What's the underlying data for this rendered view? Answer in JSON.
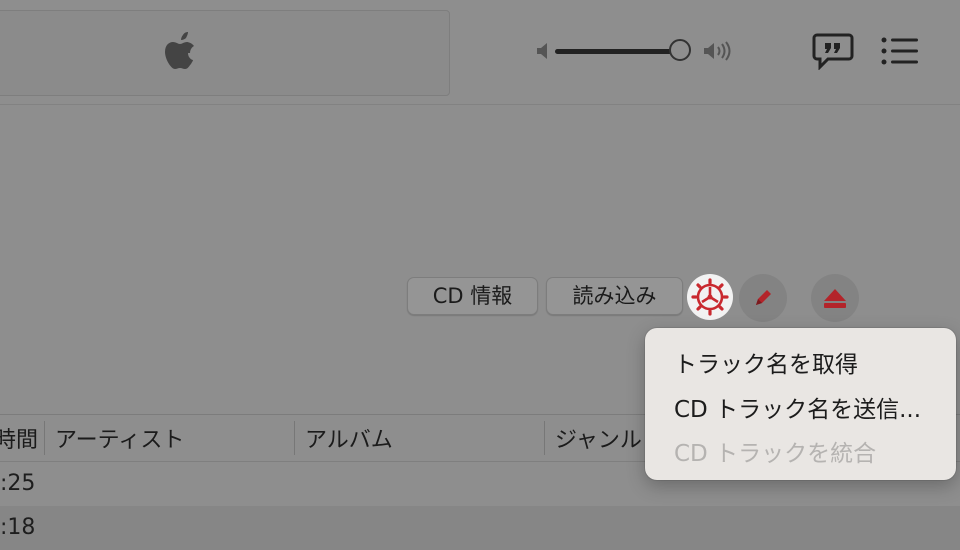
{
  "colors": {
    "accent_red": "#c9292f",
    "menu_bg": "#e9e6e3",
    "menu_disabled_text": "#b5b3b1",
    "background": "#8e8e8e"
  },
  "toolbar": {
    "logo_icon": "apple-logo",
    "volume_level": 0.92,
    "volume_low_icon": "speaker-low-icon",
    "volume_high_icon": "speaker-high-icon",
    "lyrics_icon": "quote-bubble-icon",
    "queue_icon": "list-icon"
  },
  "cd_controls": {
    "cd_info_label": "CD 情報",
    "import_label": "読み込み",
    "options_icon": "gear-icon",
    "edit_icon": "pencil-icon",
    "eject_icon": "eject-icon"
  },
  "popup_menu": {
    "items": [
      {
        "label": "トラック名を取得",
        "enabled": true
      },
      {
        "label": "CD トラック名を送信...",
        "enabled": true
      },
      {
        "label": "CD トラックを統合",
        "enabled": false
      }
    ]
  },
  "table": {
    "columns": [
      "時間",
      "アーティスト",
      "アルバム",
      "ジャンル"
    ],
    "rows": [
      {
        "time": ":25"
      },
      {
        "time": ":18"
      }
    ]
  }
}
